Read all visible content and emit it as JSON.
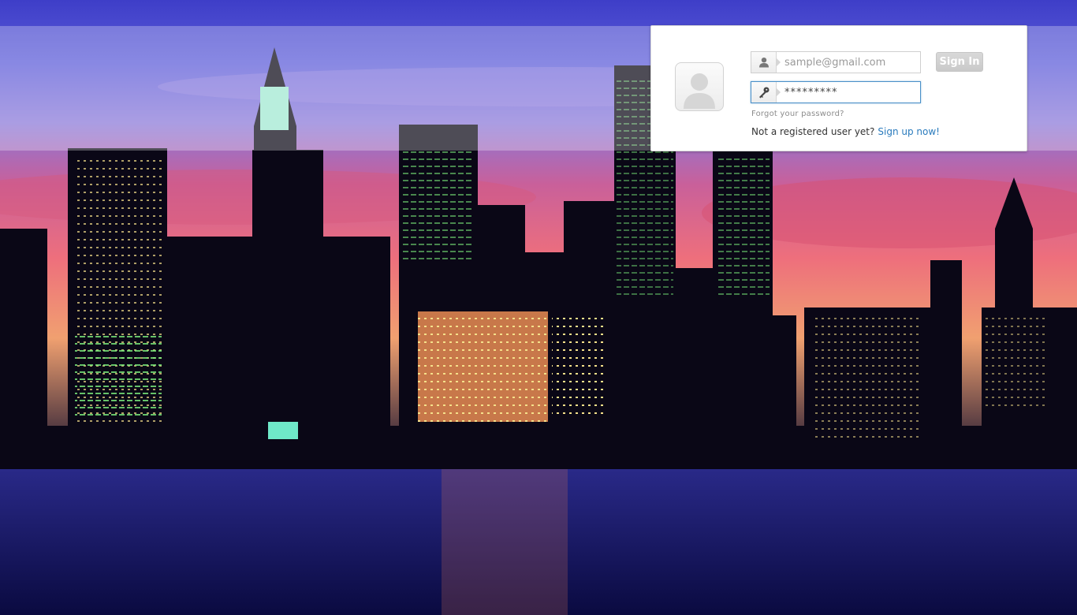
{
  "login": {
    "email_placeholder": "sample@gmail.com",
    "password_value": "*********",
    "sign_in_label": "Sign In",
    "forgot_label": "Forgot your password?",
    "register_prompt": "Not a registered user yet?",
    "signup_label": "Sign up now!"
  },
  "icons": {
    "avatar": "user-silhouette-icon",
    "email": "person-icon",
    "password": "key-icon"
  },
  "colors": {
    "link": "#2a7bbd",
    "focus_border": "#4a90c8",
    "button_bg": "#d2d2d2"
  }
}
